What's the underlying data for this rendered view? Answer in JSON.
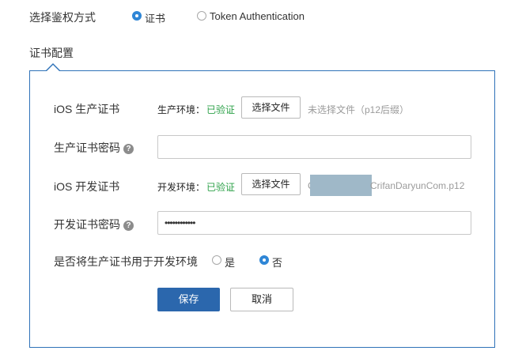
{
  "auth": {
    "label": "选择鉴权方式",
    "options": [
      {
        "label": "证书",
        "selected": true
      },
      {
        "label": "Token Authentication",
        "selected": false
      }
    ]
  },
  "cert_config": {
    "title": "证书配置",
    "ios_prod": {
      "label": "iOS 生产证书",
      "env_label": "生产环境：",
      "status": "已验证",
      "choose_label": "选择文件",
      "file_text": "未选择文件（p12后缀）"
    },
    "prod_password": {
      "label": "生产证书密码",
      "help": "?",
      "value": ""
    },
    "ios_dev": {
      "label": "iOS 开发证书",
      "env_label": "开发环境：",
      "status": "已验证",
      "choose_label": "选择文件",
      "file_text_prefix": "C",
      "file_text_suffix": "CrifanDaryunCom.p12"
    },
    "dev_password": {
      "label": "开发证书密码",
      "help": "?",
      "value": "••••••••••••"
    },
    "use_prod_for_dev": {
      "label": "是否将生产证书用于开发环境",
      "options": [
        {
          "label": "是",
          "selected": false
        },
        {
          "label": "否",
          "selected": true
        }
      ]
    },
    "save_label": "保存",
    "cancel_label": "取消"
  },
  "colors": {
    "accent": "#2f72b8",
    "primary_button": "#2b67ad",
    "verified": "#2ea24a",
    "redaction": "#9fb8c8"
  }
}
